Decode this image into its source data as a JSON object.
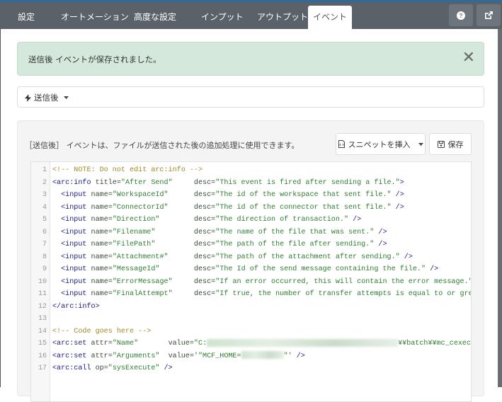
{
  "tabs": [
    {
      "label": "設定",
      "active": false
    },
    {
      "label": "オートメーション",
      "active": false
    },
    {
      "label": "高度な設定",
      "active": false
    },
    {
      "label": "インプット",
      "active": false
    },
    {
      "label": "アウトプット",
      "active": false
    },
    {
      "label": "イベント",
      "active": true
    }
  ],
  "toolbar": {
    "help_icon": "question-circle-icon",
    "external_icon": "external-link-icon"
  },
  "alert": {
    "message": "送信後 イベントが保存されました。",
    "close_label": "✕"
  },
  "event_selector": {
    "icon": "bolt-icon",
    "selected": "送信後"
  },
  "panel": {
    "description": "［送信後］ イベントは、ファイルが送信された後の追加処理に使用できます。",
    "insert_snippet_label": "スニペットを挿入",
    "save_label": "保存"
  },
  "colors": {
    "alert_bg": "#d4e8dc",
    "topbar": "#5b6169",
    "accent": "#2f6a9a"
  },
  "code_lines": [
    [
      [
        "comment",
        "<!-- NOTE: Do not edit arc:info -->"
      ]
    ],
    [
      [
        "tag",
        "<arc:info "
      ],
      [
        "attr",
        "title="
      ],
      [
        "str",
        "\"After Send\""
      ],
      [
        "plain",
        "     "
      ],
      [
        "attr",
        "desc="
      ],
      [
        "str",
        "\"This event is fired after sending a file.\""
      ],
      [
        "tag",
        ">"
      ]
    ],
    [
      [
        "plain",
        "  "
      ],
      [
        "tag",
        "<input "
      ],
      [
        "attr",
        "name="
      ],
      [
        "str",
        "\"WorkspaceId\""
      ],
      [
        "plain",
        "      "
      ],
      [
        "attr",
        "desc="
      ],
      [
        "str",
        "\"The id of the workspace that sent file.\""
      ],
      [
        "tag",
        " />"
      ]
    ],
    [
      [
        "plain",
        "  "
      ],
      [
        "tag",
        "<input "
      ],
      [
        "attr",
        "name="
      ],
      [
        "str",
        "\"ConnectorId\""
      ],
      [
        "plain",
        "      "
      ],
      [
        "attr",
        "desc="
      ],
      [
        "str",
        "\"The id of the connector that sent file.\""
      ],
      [
        "tag",
        " />"
      ]
    ],
    [
      [
        "plain",
        "  "
      ],
      [
        "tag",
        "<input "
      ],
      [
        "attr",
        "name="
      ],
      [
        "str",
        "\"Direction\""
      ],
      [
        "plain",
        "        "
      ],
      [
        "attr",
        "desc="
      ],
      [
        "str",
        "\"The direction of transaction.\""
      ],
      [
        "tag",
        " />"
      ]
    ],
    [
      [
        "plain",
        "  "
      ],
      [
        "tag",
        "<input "
      ],
      [
        "attr",
        "name="
      ],
      [
        "str",
        "\"Filename\""
      ],
      [
        "plain",
        "         "
      ],
      [
        "attr",
        "desc="
      ],
      [
        "str",
        "\"The name of the file that was sent.\""
      ],
      [
        "tag",
        " />"
      ]
    ],
    [
      [
        "plain",
        "  "
      ],
      [
        "tag",
        "<input "
      ],
      [
        "attr",
        "name="
      ],
      [
        "str",
        "\"FilePath\""
      ],
      [
        "plain",
        "         "
      ],
      [
        "attr",
        "desc="
      ],
      [
        "str",
        "\"The path of the file after sending.\""
      ],
      [
        "tag",
        " />"
      ]
    ],
    [
      [
        "plain",
        "  "
      ],
      [
        "tag",
        "<input "
      ],
      [
        "attr",
        "name="
      ],
      [
        "str",
        "\"Attachment#\""
      ],
      [
        "plain",
        "      "
      ],
      [
        "attr",
        "desc="
      ],
      [
        "str",
        "\"The path of the attachment after sending.\""
      ],
      [
        "tag",
        " />"
      ]
    ],
    [
      [
        "plain",
        "  "
      ],
      [
        "tag",
        "<input "
      ],
      [
        "attr",
        "name="
      ],
      [
        "str",
        "\"MessageId\""
      ],
      [
        "plain",
        "        "
      ],
      [
        "attr",
        "desc="
      ],
      [
        "str",
        "\"The Id of the send message containing the file.\""
      ],
      [
        "tag",
        " />"
      ]
    ],
    [
      [
        "plain",
        "  "
      ],
      [
        "tag",
        "<input "
      ],
      [
        "attr",
        "name="
      ],
      [
        "str",
        "\"ErrorMessage\""
      ],
      [
        "plain",
        "     "
      ],
      [
        "attr",
        "desc="
      ],
      [
        "str",
        "\"If an error occurred, this will contain the error message.\""
      ]
    ],
    [
      [
        "plain",
        "  "
      ],
      [
        "tag",
        "<input "
      ],
      [
        "attr",
        "name="
      ],
      [
        "str",
        "\"FinalAttempt\""
      ],
      [
        "plain",
        "     "
      ],
      [
        "attr",
        "desc="
      ],
      [
        "str",
        "\"If true, the number of transfer attempts is equal to or grea"
      ]
    ],
    [
      [
        "tag",
        "</arc:info>"
      ]
    ],
    [],
    [
      [
        "comment",
        "<!-- Code goes here -->"
      ]
    ],
    [
      [
        "tag",
        "<arc:set "
      ],
      [
        "attr",
        "attr="
      ],
      [
        "str",
        "\"Name\""
      ],
      [
        "plain",
        "       "
      ],
      [
        "attr",
        "value="
      ],
      [
        "str",
        "\"C:"
      ],
      [
        "blur",
        "270"
      ],
      [
        "str",
        "¥¥batch¥¥mc_cexec.ex"
      ]
    ],
    [
      [
        "tag",
        "<arc:set "
      ],
      [
        "attr",
        "attr="
      ],
      [
        "str",
        "\"Arguments\""
      ],
      [
        "plain",
        "  "
      ],
      [
        "attr",
        "value="
      ],
      [
        "str",
        "'\"MCF_HOME="
      ],
      [
        "blur",
        "60"
      ],
      [
        "str",
        "\"'"
      ],
      [
        "tag",
        " />"
      ]
    ],
    [
      [
        "tag",
        "<arc:call "
      ],
      [
        "attr",
        "op="
      ],
      [
        "str",
        "\"sysExecute\""
      ],
      [
        "tag",
        " />"
      ]
    ]
  ]
}
